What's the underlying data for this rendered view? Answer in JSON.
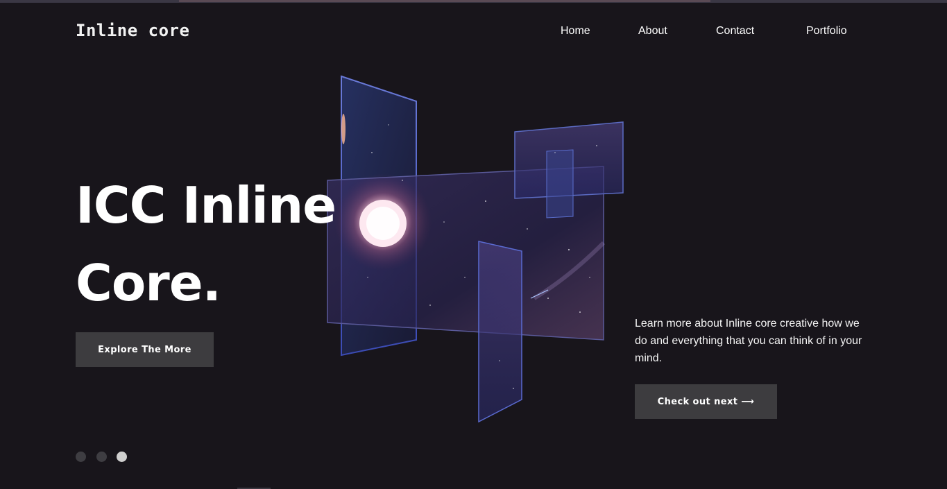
{
  "brand": {
    "logo_text": "Inline core"
  },
  "nav": {
    "items": [
      {
        "label": "Home"
      },
      {
        "label": "About"
      },
      {
        "label": "Contact"
      },
      {
        "label": "Portfolio"
      }
    ]
  },
  "hero": {
    "title_line1": "ICC Inline",
    "title_line2": "Core.",
    "explore_label": "Explore The More",
    "description": "Learn more about Inline core creative how we do and everything that you can think of in your mind.",
    "next_label": "Check out next ⟶"
  },
  "slider": {
    "dot_count": 3,
    "active_index": 2
  },
  "colors": {
    "background": "#18151b",
    "button": "#3d3c3f",
    "dot_inactive": "#3e3d42",
    "dot_active": "#cfcfcf"
  }
}
